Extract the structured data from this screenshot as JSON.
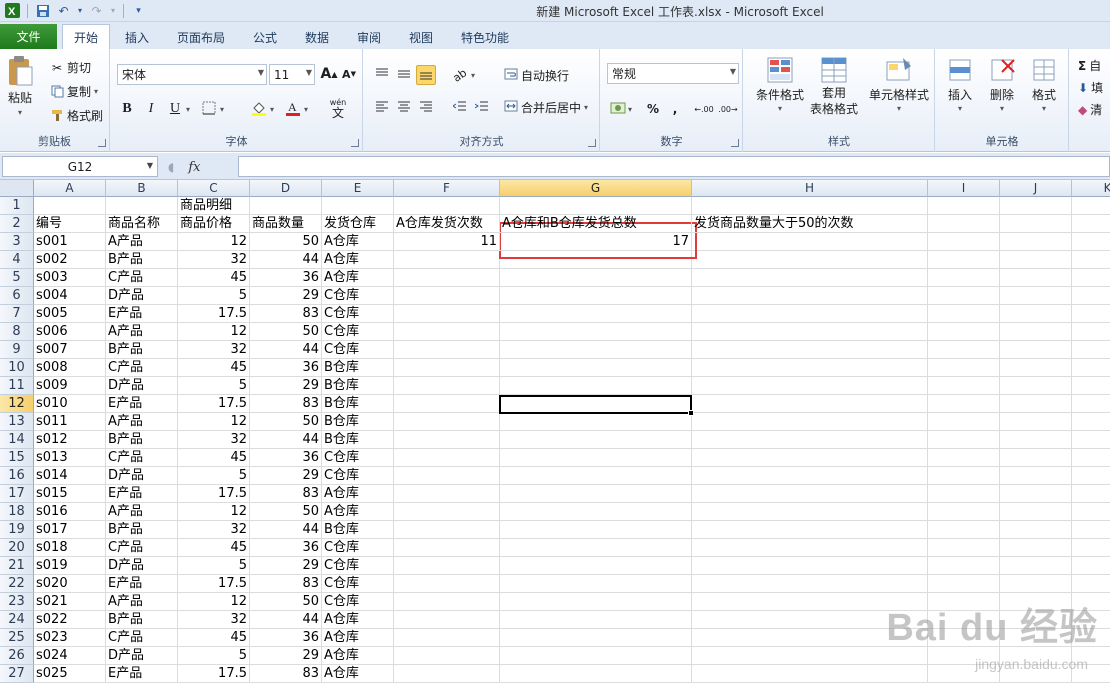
{
  "window": {
    "title": "新建 Microsoft Excel 工作表.xlsx  -  Microsoft Excel"
  },
  "tabs": [
    {
      "label": "文件",
      "name": "tab-file"
    },
    {
      "label": "开始",
      "name": "tab-home"
    },
    {
      "label": "插入",
      "name": "tab-insert"
    },
    {
      "label": "页面布局",
      "name": "tab-page-layout"
    },
    {
      "label": "公式",
      "name": "tab-formulas"
    },
    {
      "label": "数据",
      "name": "tab-data"
    },
    {
      "label": "审阅",
      "name": "tab-review"
    },
    {
      "label": "视图",
      "name": "tab-view"
    },
    {
      "label": "特色功能",
      "name": "tab-features"
    }
  ],
  "ribbon": {
    "clipboard": {
      "label": "剪贴板",
      "paste": "粘贴",
      "cut": "剪切",
      "copy": "复制",
      "format_painter": "格式刷"
    },
    "font": {
      "label": "字体",
      "font_name": "宋体",
      "font_size": "11",
      "grow": "A",
      "shrink": "A",
      "bold": "B",
      "italic": "I",
      "underline": "U",
      "wen": "wén",
      "wen_char": "文"
    },
    "alignment": {
      "label": "对齐方式",
      "wrap_text": "自动换行",
      "merge_center": "合并后居中"
    },
    "number": {
      "label": "数字",
      "format": "常规",
      "percent": "%",
      "comma": ",",
      "inc_decimal": ".00",
      "dec_decimal": ".00"
    },
    "styles": {
      "label": "样式",
      "conditional": "条件格式",
      "table_format_1": "套用",
      "table_format_2": "表格格式",
      "cell_styles": "单元格样式"
    },
    "cells": {
      "label": "单元格",
      "insert": "插入",
      "delete": "删除",
      "format": "格式"
    },
    "editing": {
      "autosum": "自",
      "fill": "填",
      "clear": "清"
    }
  },
  "formula_bar": {
    "name_box": "G12",
    "fx": "fx",
    "value": ""
  },
  "columns": [
    "A",
    "B",
    "C",
    "D",
    "E",
    "F",
    "G",
    "H",
    "I",
    "J",
    "K"
  ],
  "selected_column": "G",
  "selected_row": "12",
  "sheet": {
    "title": "商品明细",
    "headers": [
      "编号",
      "商品名称",
      "商品价格",
      "商品数量",
      "发货仓库",
      "A仓库发货次数",
      "A仓库和B仓库发货总数",
      "发货商品数量大于50的次数"
    ],
    "results": {
      "f3": "11",
      "g3": "17"
    },
    "rows": [
      [
        "3",
        "s001",
        "A产品",
        "12",
        "50",
        "A仓库"
      ],
      [
        "4",
        "s002",
        "B产品",
        "32",
        "44",
        "A仓库"
      ],
      [
        "5",
        "s003",
        "C产品",
        "45",
        "36",
        "A仓库"
      ],
      [
        "6",
        "s004",
        "D产品",
        "5",
        "29",
        "C仓库"
      ],
      [
        "7",
        "s005",
        "E产品",
        "17.5",
        "83",
        "C仓库"
      ],
      [
        "8",
        "s006",
        "A产品",
        "12",
        "50",
        "C仓库"
      ],
      [
        "9",
        "s007",
        "B产品",
        "32",
        "44",
        "C仓库"
      ],
      [
        "10",
        "s008",
        "C产品",
        "45",
        "36",
        "B仓库"
      ],
      [
        "11",
        "s009",
        "D产品",
        "5",
        "29",
        "B仓库"
      ],
      [
        "12",
        "s010",
        "E产品",
        "17.5",
        "83",
        "B仓库"
      ],
      [
        "13",
        "s011",
        "A产品",
        "12",
        "50",
        "B仓库"
      ],
      [
        "14",
        "s012",
        "B产品",
        "32",
        "44",
        "B仓库"
      ],
      [
        "15",
        "s013",
        "C产品",
        "45",
        "36",
        "C仓库"
      ],
      [
        "16",
        "s014",
        "D产品",
        "5",
        "29",
        "C仓库"
      ],
      [
        "17",
        "s015",
        "E产品",
        "17.5",
        "83",
        "A仓库"
      ],
      [
        "18",
        "s016",
        "A产品",
        "12",
        "50",
        "A仓库"
      ],
      [
        "19",
        "s017",
        "B产品",
        "32",
        "44",
        "B仓库"
      ],
      [
        "20",
        "s018",
        "C产品",
        "45",
        "36",
        "C仓库"
      ],
      [
        "21",
        "s019",
        "D产品",
        "5",
        "29",
        "C仓库"
      ],
      [
        "22",
        "s020",
        "E产品",
        "17.5",
        "83",
        "C仓库"
      ],
      [
        "23",
        "s021",
        "A产品",
        "12",
        "50",
        "C仓库"
      ],
      [
        "24",
        "s022",
        "B产品",
        "32",
        "44",
        "A仓库"
      ],
      [
        "25",
        "s023",
        "C产品",
        "45",
        "36",
        "A仓库"
      ],
      [
        "26",
        "s024",
        "D产品",
        "5",
        "29",
        "A仓库"
      ],
      [
        "27",
        "s025",
        "E产品",
        "17.5",
        "83",
        "A仓库"
      ]
    ]
  },
  "watermark": {
    "main": "Bai du 经验",
    "sub": "jingyan.baidu.com"
  },
  "colors": {
    "file_tab": "#2a8a27",
    "selection_header": "#f7cf6b",
    "highlight_box": "#e03a3a"
  }
}
